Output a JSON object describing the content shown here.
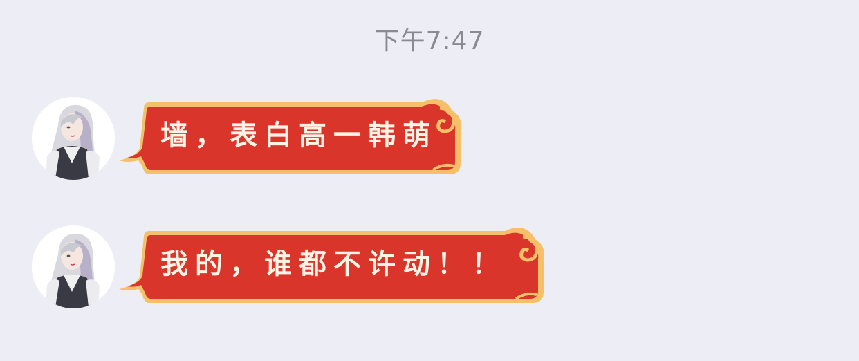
{
  "timestamp": "下午7:47",
  "colors": {
    "bubble_red": "#d9352a",
    "bubble_border": "#f6c06a",
    "background": "#ededf5"
  },
  "messages": [
    {
      "sender": "avatar",
      "text": "墙，表白高一韩萌"
    },
    {
      "sender": "avatar",
      "text": "我的，谁都不许动！！"
    }
  ]
}
